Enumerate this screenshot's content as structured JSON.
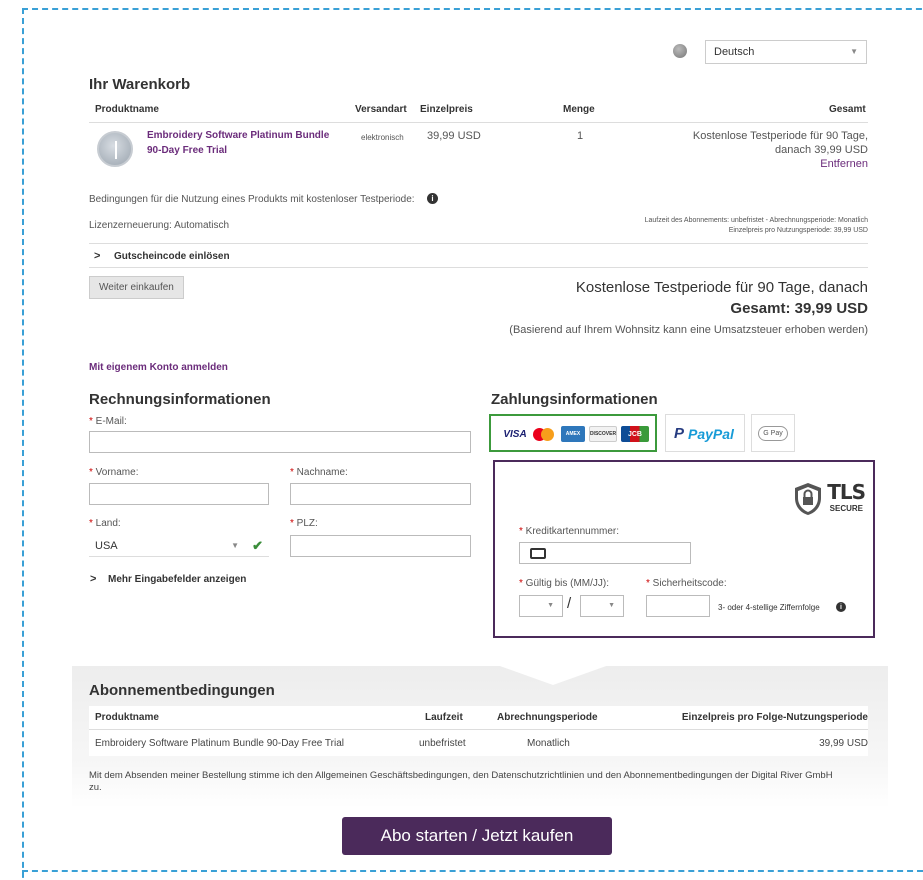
{
  "language": {
    "selected": "Deutsch"
  },
  "cart": {
    "title": "Ihr Warenkorb",
    "headers": {
      "product": "Produktname",
      "shipping": "Versandart",
      "unit_price": "Einzelpreis",
      "qty": "Menge",
      "total": "Gesamt"
    },
    "item": {
      "name_line1": "Embroidery Software Platinum Bundle",
      "name_line2": "90-Day Free Trial",
      "shipping": "elektronisch",
      "price": "39,99 USD",
      "qty": "1",
      "total_line1": "Kostenlose Testperiode für 90 Tage,",
      "total_line2": "danach 39,99 USD",
      "remove": "Entfernen"
    },
    "trial_terms": "Bedingungen für die Nutzung eines Produkts mit kostenloser Testperiode:",
    "renewal": "Lizenzerneuerung: Automatisch",
    "subscription_term": "Laufzeit des Abonnements: unbefristet - Abrechnungsperiode: Monatlich",
    "unit_price_period": "Einzelpreis pro Nutzungsperiode: 39,99 USD",
    "coupon": "Gutscheincode einlösen",
    "continue_shopping": "Weiter einkaufen",
    "summary_line1": "Kostenlose Testperiode für 90 Tage, danach",
    "summary_total_label": "Gesamt:",
    "summary_total_value": "39,99 USD",
    "tax_note": "(Basierend auf Ihrem Wohnsitz kann eine Umsatzsteuer erhoben werden)"
  },
  "login_link": "Mit eigenem Konto anmelden",
  "billing": {
    "title": "Rechnungsinformationen",
    "email_label": "E-Mail:",
    "firstname_label": "Vorname:",
    "lastname_label": "Nachname:",
    "country_label": "Land:",
    "country_value": "USA",
    "zip_label": "PLZ:",
    "more_fields": "Mehr Eingabefelder anzeigen",
    "required_mark": "*"
  },
  "payment": {
    "title": "Zahlungsinformationen",
    "paypal": "PayPal",
    "gpay": "G Pay",
    "tls_title": "TLS",
    "tls_sub": "SECURE",
    "card_number_label": "Kreditkartennummer:",
    "expiry_label": "Gültig bis (MM/JJ):",
    "cvv_label": "Sicherheitscode:",
    "cvv_hint": "3- oder 4-stellige Ziffernfolge",
    "slash": "/",
    "visa": "VISA",
    "amex": "AMEX",
    "discover": "DISCOVER",
    "jcb": "JCB"
  },
  "subscription": {
    "title": "Abonnementbedingungen",
    "headers": {
      "product": "Produktname",
      "term": "Laufzeit",
      "period": "Abrechnungsperiode",
      "price": "Einzelpreis pro Folge-Nutzungsperiode"
    },
    "row": {
      "product": "Embroidery Software Platinum Bundle 90-Day Free Trial",
      "term": "unbefristet",
      "period": "Monatlich",
      "price": "39,99 USD"
    },
    "legal_line1": "Mit dem Absenden meiner Bestellung stimme ich den Allgemeinen Geschäftsbedingungen, den Datenschutzrichtlinien und den Abonnementbedingungen der Digital River GmbH",
    "legal_line2": "zu."
  },
  "cta": "Abo starten / Jetzt kaufen"
}
